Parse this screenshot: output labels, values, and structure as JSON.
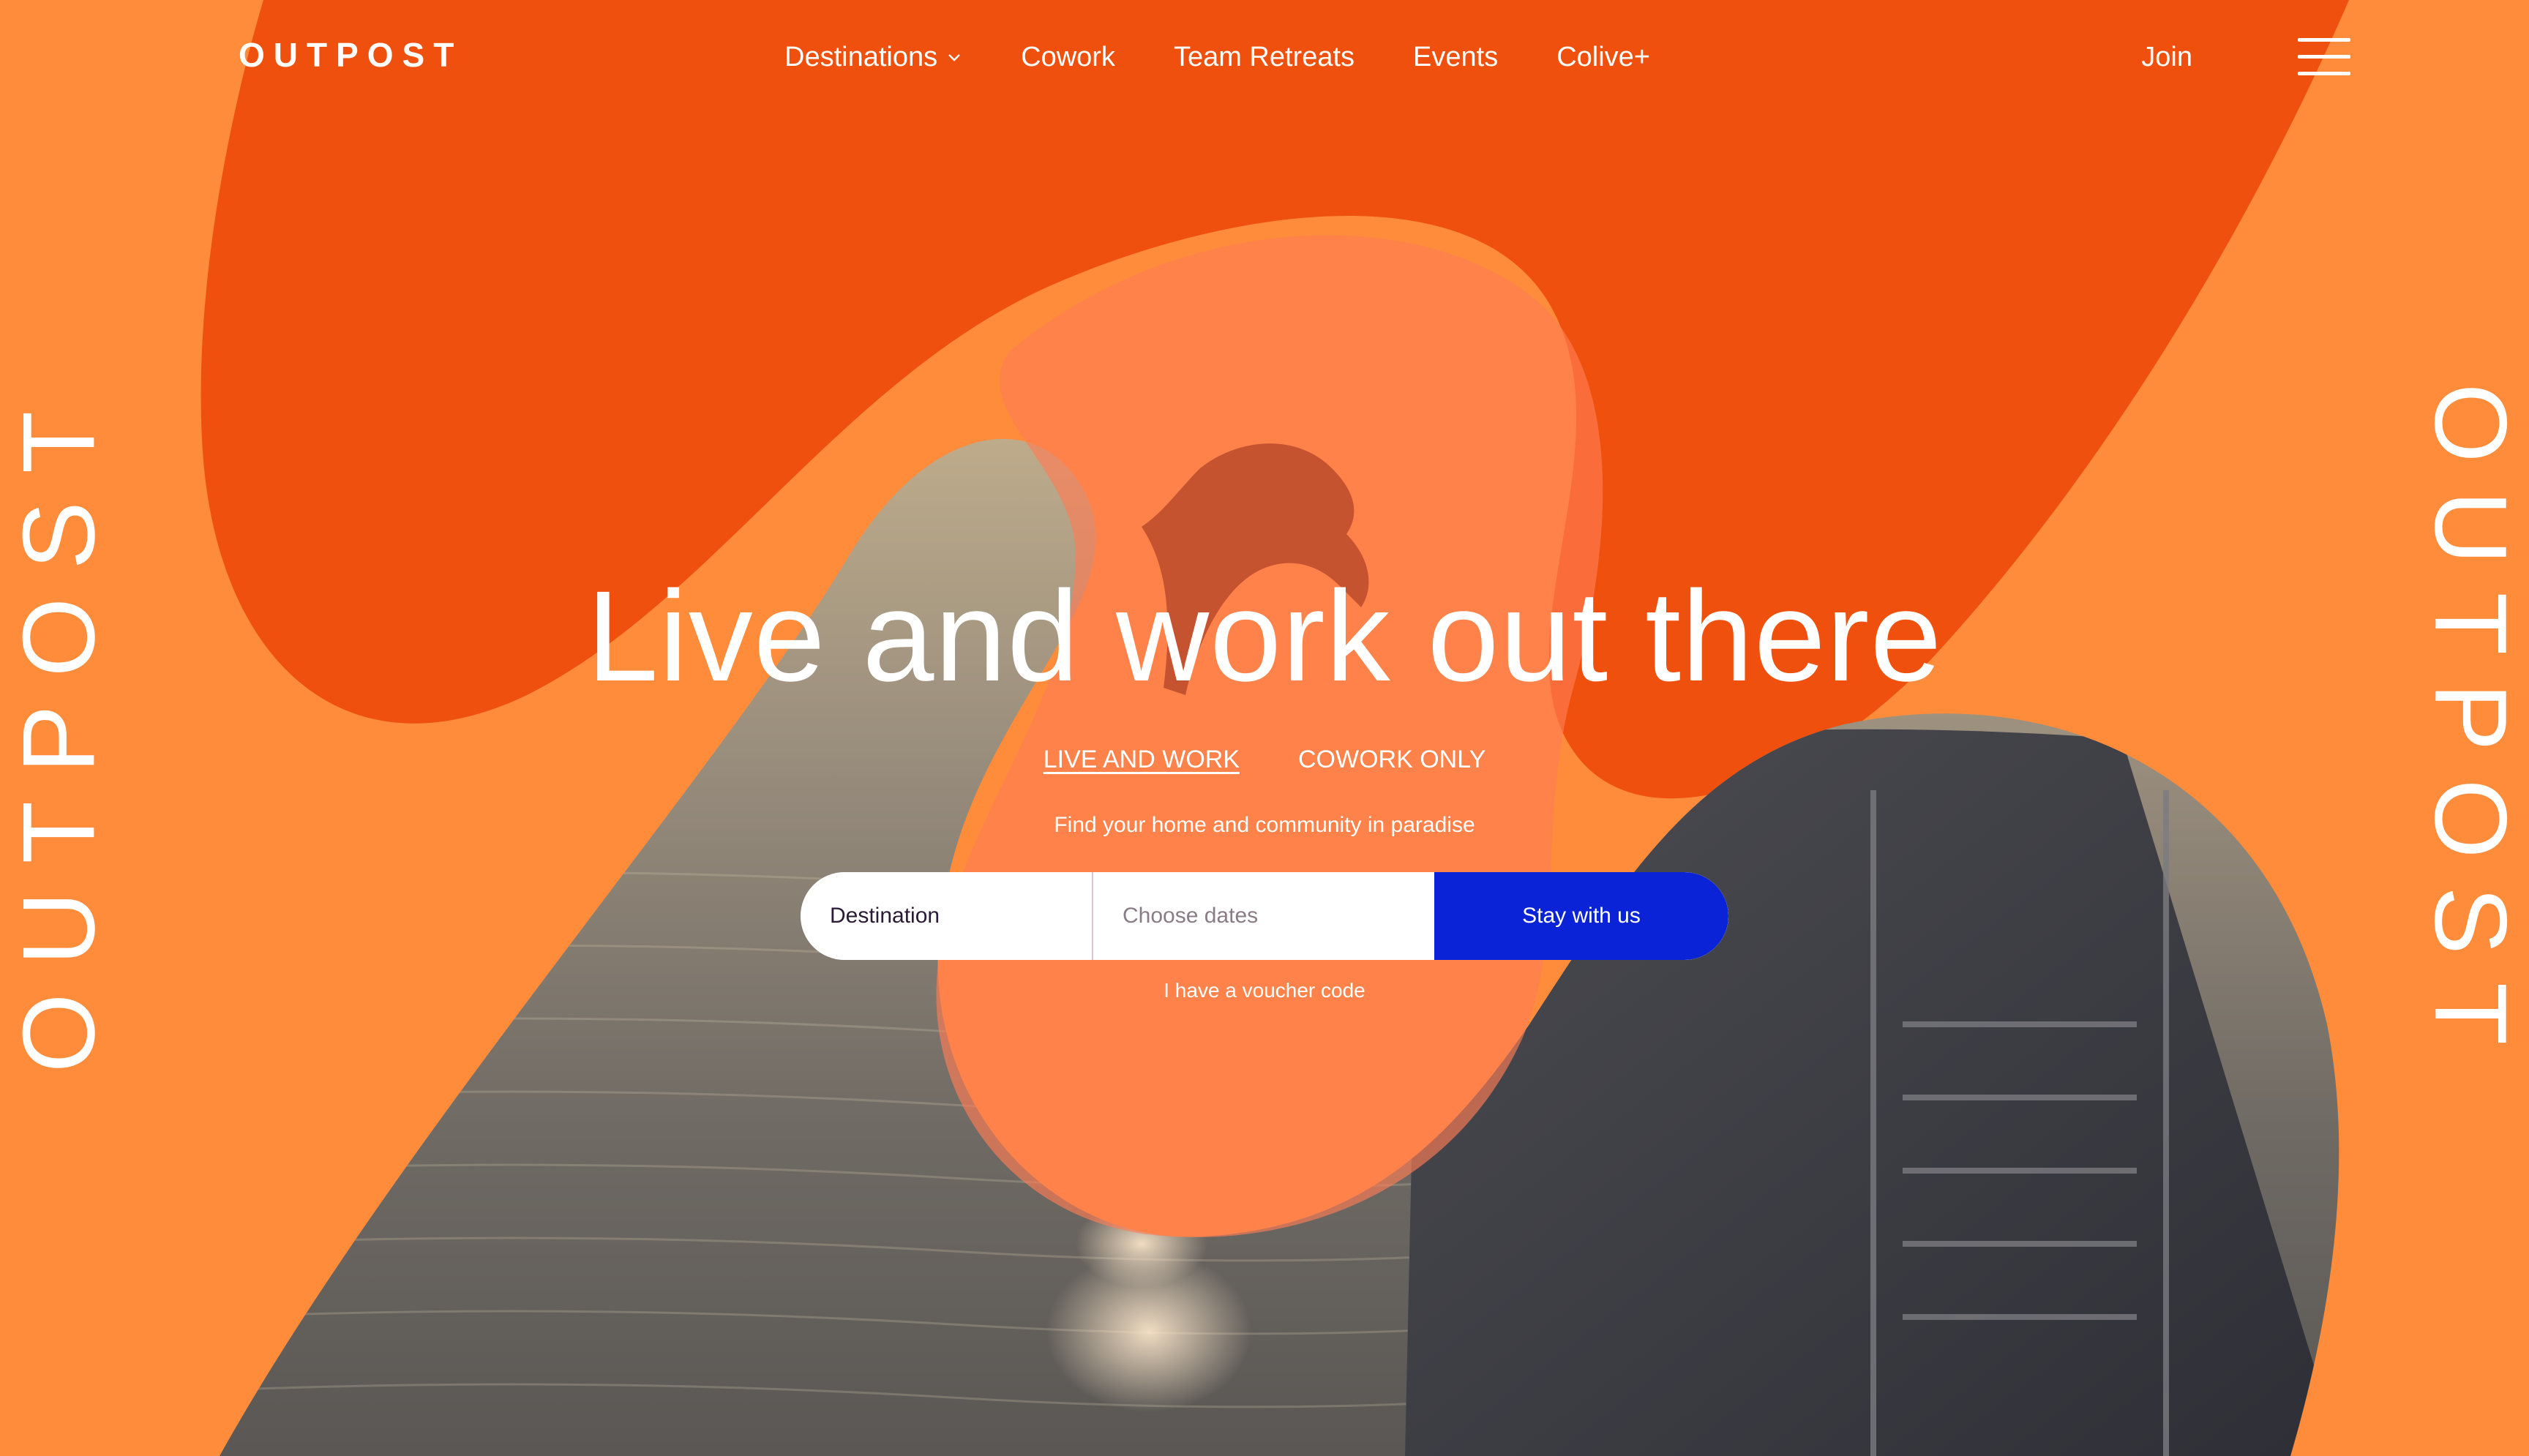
{
  "brand": {
    "logo_text": "OUTPOST",
    "side_text_left": "OUTPOST",
    "side_text_right": "OUTPOST"
  },
  "nav": {
    "items": [
      {
        "label": "Destinations",
        "has_dropdown": true
      },
      {
        "label": "Cowork",
        "has_dropdown": false
      },
      {
        "label": "Team Retreats",
        "has_dropdown": false
      },
      {
        "label": "Events",
        "has_dropdown": false
      },
      {
        "label": "Colive+",
        "has_dropdown": false
      }
    ],
    "join_label": "Join",
    "menu_icon": "hamburger-icon",
    "dropdown_icon": "chevron-down-icon"
  },
  "hero": {
    "title": "Live and work out there",
    "tabs": [
      {
        "label": "LIVE AND WORK",
        "active": true
      },
      {
        "label": "COWORK ONLY",
        "active": false
      }
    ],
    "tagline": "Find your home and community in paradise"
  },
  "search": {
    "destination_placeholder": "Destination",
    "dates_placeholder": "Choose dates",
    "submit_label": "Stay with us",
    "voucher_label": "I have a voucher code"
  },
  "colors": {
    "light_orange": "#FF8C3B",
    "deep_orange": "#F0500D",
    "button_blue": "#0A23D6",
    "white": "#FFFFFF"
  }
}
